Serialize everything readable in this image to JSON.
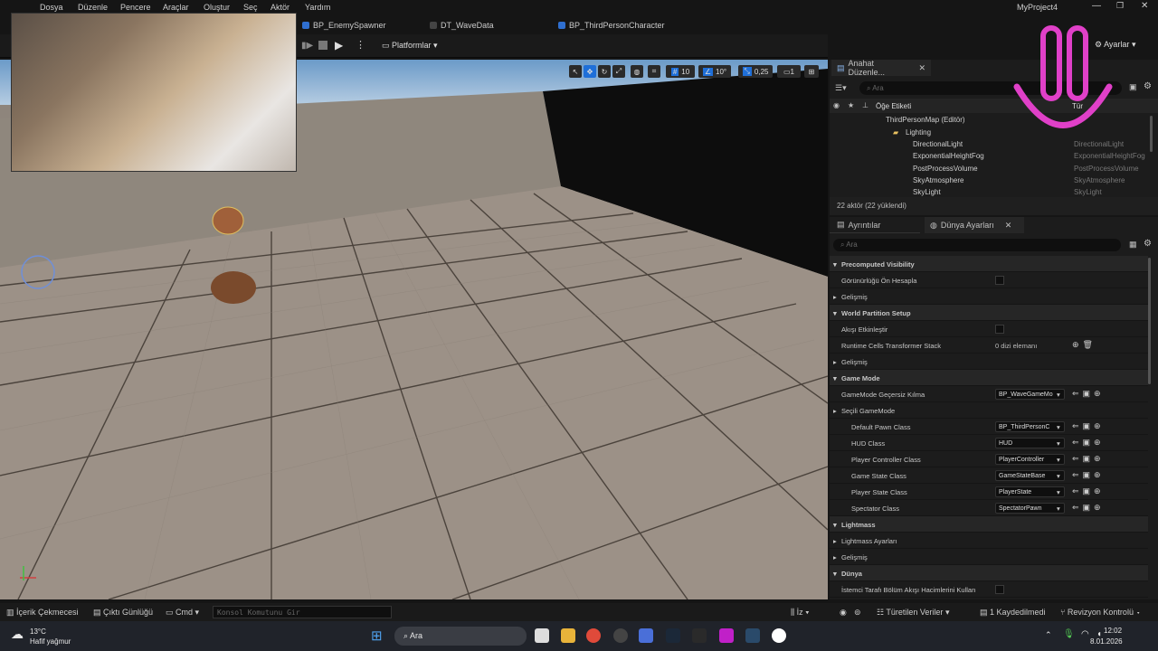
{
  "menu": [
    "Dosya",
    "Düzenle",
    "Pencere",
    "Araçlar",
    "Oluştur",
    "Seç",
    "Aktör",
    "Yardım"
  ],
  "project_name": "MyProject4",
  "tabs": [
    "BP_EnemySpawner",
    "DT_WaveData",
    "BP_ThirdPersonCharacter"
  ],
  "toolbar": {
    "platforms": "Platformlar",
    "settings": "Ayarlar"
  },
  "viewport": {
    "grid_size": "10",
    "rotation_snap": "10°",
    "scale_snap": "0,25",
    "camera_speed": "1"
  },
  "outliner": {
    "tab_title": "Anahat Düzenle...",
    "search_placeholder": "Ara",
    "col_label": "Öğe Etiketi",
    "col_type": "Tür",
    "rows": [
      {
        "name": "ThirdPersonMap (Editör)",
        "type": ""
      },
      {
        "name": "Lighting",
        "type": ""
      },
      {
        "name": "DirectionalLight",
        "type": "DirectionalLight"
      },
      {
        "name": "ExponentialHeightFog",
        "type": "ExponentialHeightFog"
      },
      {
        "name": "PostProcessVolume",
        "type": "PostProcessVolume"
      },
      {
        "name": "SkyAtmosphere",
        "type": "SkyAtmosphere"
      },
      {
        "name": "SkyLight",
        "type": "SkyLight"
      }
    ],
    "footer": "22 aktör (22 yüklendi)"
  },
  "details": {
    "tab1": "Ayrıntılar",
    "tab2": "Dünya Ayarları",
    "search_placeholder": "Ara",
    "rows": [
      {
        "kind": "cat",
        "label": "Precomputed Visibility"
      },
      {
        "kind": "check",
        "label": "Görünürlüğü Ön Hesapla"
      },
      {
        "kind": "sub",
        "label": "Gelişmiş"
      },
      {
        "kind": "cat",
        "label": "World Partition Setup"
      },
      {
        "kind": "check",
        "label": "Akışı Etkinleştir"
      },
      {
        "kind": "text",
        "label": "Runtime Cells Transformer Stack",
        "value": "0 dizi elemanı"
      },
      {
        "kind": "sub",
        "label": "Gelişmiş"
      },
      {
        "kind": "cat",
        "label": "Game Mode"
      },
      {
        "kind": "combo",
        "label": "GameMode Geçersiz Kılma",
        "value": "BP_WaveGameMo"
      },
      {
        "kind": "sub",
        "label": "Seçili GameMode"
      },
      {
        "kind": "combo2",
        "label": "Default Pawn Class",
        "value": "BP_ThirdPersonC"
      },
      {
        "kind": "combo2",
        "label": "HUD Class",
        "value": "HUD"
      },
      {
        "kind": "combo2",
        "label": "Player Controller Class",
        "value": "PlayerController"
      },
      {
        "kind": "combo2",
        "label": "Game State Class",
        "value": "GameStateBase"
      },
      {
        "kind": "combo2",
        "label": "Player State Class",
        "value": "PlayerState"
      },
      {
        "kind": "combo2",
        "label": "Spectator Class",
        "value": "SpectatorPawn"
      },
      {
        "kind": "cat",
        "label": "Lightmass"
      },
      {
        "kind": "sub",
        "label": "Lightmass Ayarları"
      },
      {
        "kind": "sub",
        "label": "Gelişmiş"
      },
      {
        "kind": "cat",
        "label": "Dünya"
      },
      {
        "kind": "check",
        "label": "İstemci Tarafı Bölüm Akışı Hacimlerini Kullan"
      }
    ]
  },
  "bottombar": {
    "content_drawer": "İçerik Çekmecesi",
    "output_log": "Çıktı Günlüğü",
    "cmd": "Cmd",
    "console_placeholder": "Konsol Komutunu Gir",
    "iz": "İz",
    "derived_data": "Türetilen Veriler",
    "unsaved": "1 Kaydedilmedi",
    "revision": "Revizyon Kontrolü"
  },
  "taskbar": {
    "temp": "13°C",
    "weather": "Hafif yağmur",
    "search": "Ara",
    "time": "12:02",
    "date": "8.01.2026"
  },
  "colors": {
    "accent": "#1f6fd8",
    "overlay_pink": "#e040c8"
  }
}
